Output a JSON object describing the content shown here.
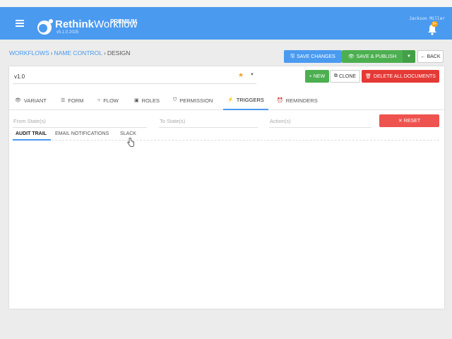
{
  "app": {
    "brand_rethink": "Rethink",
    "brand_workflow": "Workflow",
    "version": "v5.1.0.2025",
    "edition": "PREMIUM",
    "user_name": "Jackson Miller",
    "notification_count": "9+",
    "brand_color": "#4a9af0"
  },
  "breadcrumb": {
    "items": [
      "WORKFLOWS",
      "NAME CONTROL",
      "DESIGN"
    ]
  },
  "toolbar": {
    "save_label": "SAVE CHANGES",
    "publish_label": "SAVE & PUBLISH",
    "back_label": "BACK"
  },
  "document": {
    "version_value": "v1.0",
    "new_label": "NEW",
    "clone_label": "CLONE",
    "delete_all_label": "DELETE ALL DOCUMENTS"
  },
  "tabs": [
    {
      "label": "VARIANT",
      "icon": "eye-icon"
    },
    {
      "label": "FORM",
      "icon": "list-icon"
    },
    {
      "label": "FLOW",
      "icon": "flow-icon"
    },
    {
      "label": "ROLES",
      "icon": "roles-icon"
    },
    {
      "label": "PERMISSION",
      "icon": "shield-icon"
    },
    {
      "label": "TRIGGERS",
      "icon": "bolt-icon",
      "active": true
    },
    {
      "label": "REMINDERS",
      "icon": "alarm-icon"
    }
  ],
  "filters": {
    "from_state_placeholder": "From State(s)",
    "to_state_placeholder": "To State(s)",
    "action_placeholder": "Action(s)",
    "reset_label": "RESET"
  },
  "subtabs": [
    {
      "label": "AUDIT TRAIL",
      "active": true
    },
    {
      "label": "EMAIL NOTIFICATIONS"
    },
    {
      "label": "SLACK"
    }
  ]
}
